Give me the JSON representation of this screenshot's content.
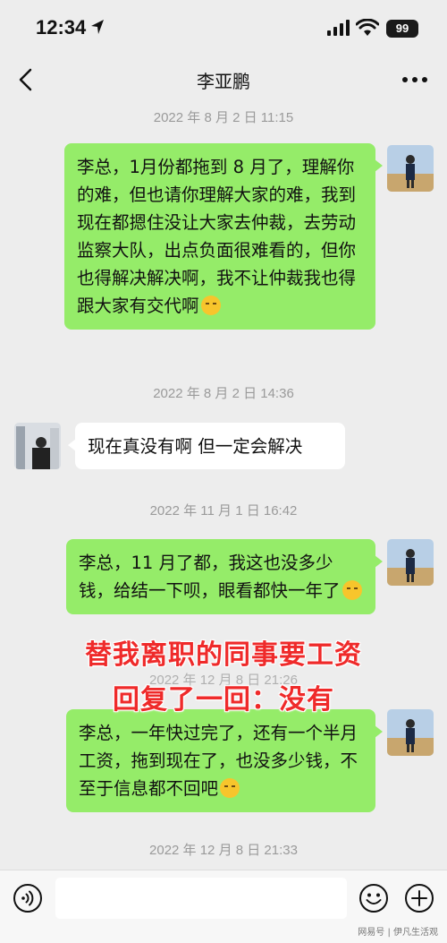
{
  "status_bar": {
    "time": "12:34",
    "battery": "99"
  },
  "header": {
    "title": "李亚鹏"
  },
  "messages": [
    {
      "timestamp": "2022 年 8 月 2 日 11:15",
      "text": "李总，1月份都拖到 8 月了，理解你的难，但也请你理解大家的难，我到现在都摁住没让大家去仲裁，去劳动监察大队，出点负面很难看的，但你也得解决解决啊，我不让仲裁我也得跟大家有交代啊"
    },
    {
      "timestamp": "2022 年 8 月 2 日 14:36",
      "text": "现在真没有啊 但一定会解决"
    },
    {
      "timestamp": "2022 年 11 月 1 日 16:42",
      "text": "李总，11 月了都，我这也没多少钱，给结一下呗，眼看都快一年了"
    },
    {
      "timestamp": "2022 年 12 月 8 日 21:26",
      "text": "李总，一年快过完了，还有一个半月工资，拖到现在了，也没多少钱，不至于信息都不回吧"
    },
    {
      "timestamp": "2022 年 12 月 8 日 21:33"
    }
  ],
  "overlay": {
    "line1": "替我离职的同事要工资",
    "line2": "回复了一回：没有"
  },
  "watermark": "网易号 | 伊凡生活观",
  "icons": [
    "location-arrow-icon",
    "signal-icon",
    "wifi-icon",
    "battery-icon",
    "back-icon",
    "more-icon",
    "voice-icon",
    "emoji-icon",
    "plus-icon"
  ],
  "colors": {
    "bubble_me": "#95ec69",
    "bubble_other": "#ffffff",
    "background": "#ededed",
    "overlay_text": "#ef2a2a"
  }
}
